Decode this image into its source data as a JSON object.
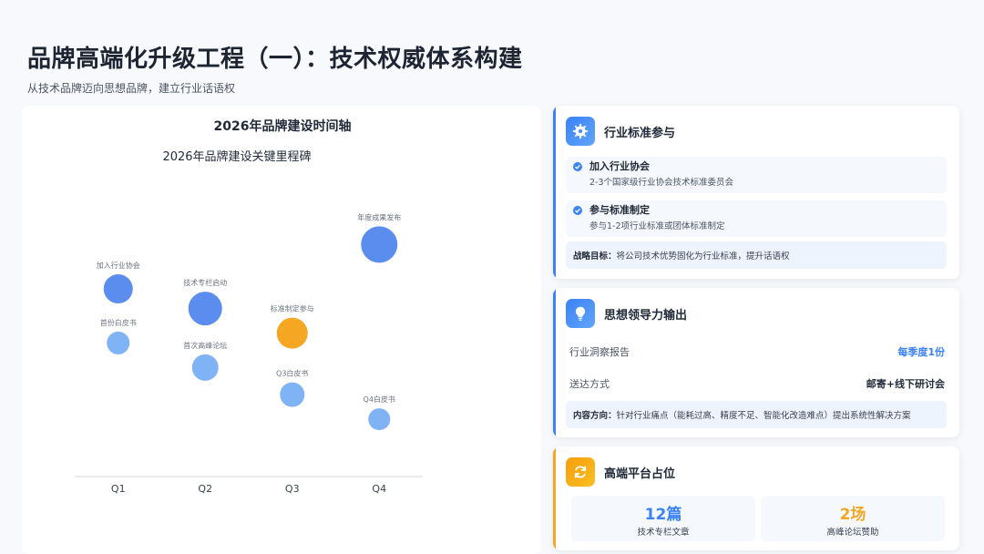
{
  "header": {
    "title": "品牌高端化升级工程（一）：技术权威体系构建",
    "subtitle": "从技术品牌迈向思想品牌，建立行业话语权"
  },
  "chart_data": {
    "type": "scatter",
    "panel_title": "2026年品牌建设时间轴",
    "title": "2026年品牌建设关键里程碑",
    "categories": [
      "Q1",
      "Q2",
      "Q3",
      "Q4"
    ],
    "y_axis_visible": false,
    "grid": false,
    "legend": "none",
    "series": [
      {
        "points": [
          {
            "x": "Q1",
            "y": 70,
            "size": 32,
            "label": "加入行业协会",
            "color": "#5b8def"
          },
          {
            "x": "Q1",
            "y": 48,
            "size": 25,
            "label": "首份白皮书",
            "color": "#7fb3f5"
          },
          {
            "x": "Q2",
            "y": 62,
            "size": 37,
            "label": "技术专栏启动",
            "color": "#5b8def"
          },
          {
            "x": "Q2",
            "y": 38,
            "size": 29,
            "label": "首次高峰论坛",
            "color": "#7fb3f5"
          },
          {
            "x": "Q3",
            "y": 52,
            "size": 34,
            "label": "标准制定参与",
            "color": "#f5a623"
          },
          {
            "x": "Q3",
            "y": 27,
            "size": 27,
            "label": "Q3白皮书",
            "color": "#7fb3f5"
          },
          {
            "x": "Q4",
            "y": 88,
            "size": 40,
            "label": "年度成果发布",
            "color": "#5b8def"
          },
          {
            "x": "Q4",
            "y": 17,
            "size": 24,
            "label": "Q4白皮书",
            "color": "#7fb3f5"
          }
        ]
      }
    ]
  },
  "cards": {
    "standards": {
      "icon": "gear-icon",
      "title": "行业标准参与",
      "items": [
        {
          "title": "加入行业协会",
          "desc": "2-3个国家级行业协会技术标准委员会"
        },
        {
          "title": "参与标准制定",
          "desc": "参与1-2项行业标准或团体标准制定"
        }
      ],
      "goal_label": "战略目标：",
      "goal_text": "将公司技术优势固化为行业标准，提升话语权"
    },
    "thought": {
      "icon": "lightbulb-icon",
      "title": "思想领导力输出",
      "rows": [
        {
          "key": "行业洞察报告",
          "value": "每季度1份"
        },
        {
          "key": "送达方式",
          "value": "邮寄+线下研讨会"
        }
      ],
      "content_label": "内容方向：",
      "content_text": "针对行业痛点（能耗过高、精度不足、智能化改造难点）提出系统性解决方案"
    },
    "platform": {
      "icon": "refresh-icon",
      "title": "高端平台占位",
      "stats": [
        {
          "value": "12篇",
          "label": "技术专栏文章",
          "color": "#3b82f6"
        },
        {
          "value": "2场",
          "label": "高峰论坛赞助",
          "color": "#f5a623"
        }
      ]
    }
  },
  "colors": {
    "accent_blue": "#3b82f6",
    "accent_orange": "#f5a623",
    "title": "#1e2532"
  }
}
